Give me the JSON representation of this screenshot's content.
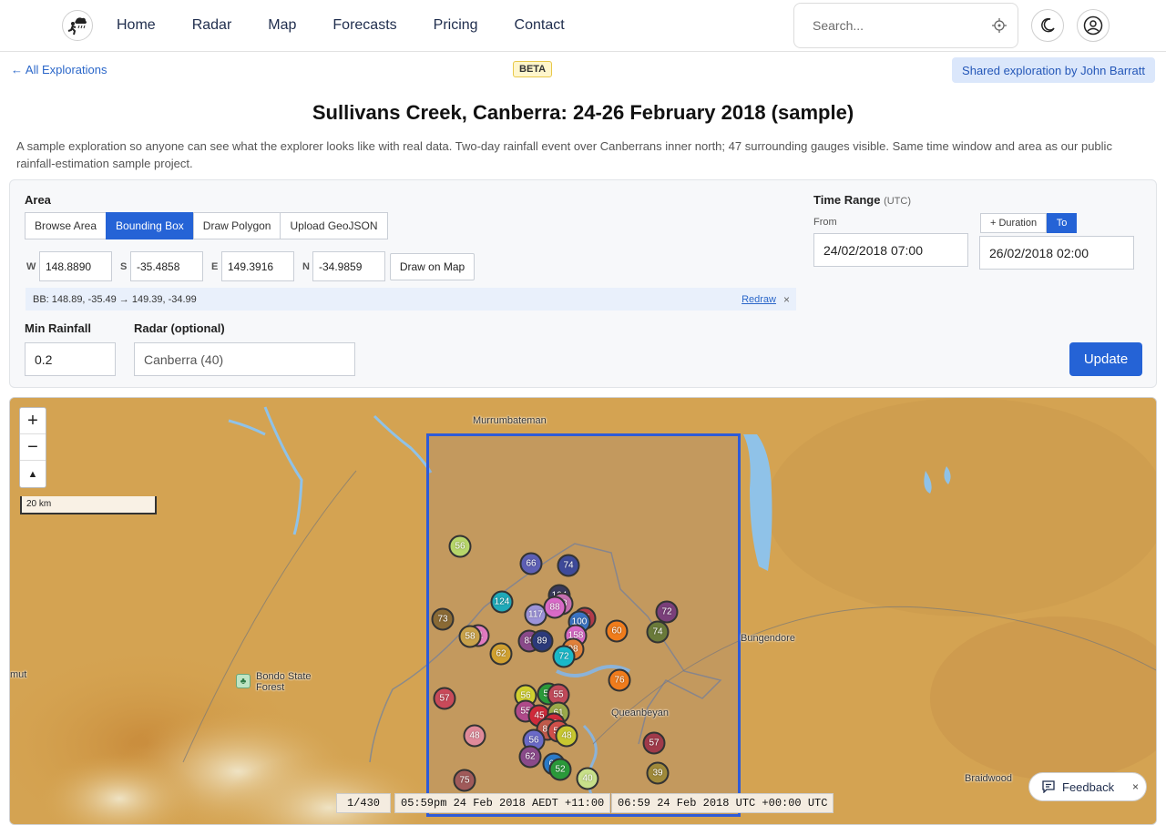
{
  "nav": {
    "links": [
      "Home",
      "Radar",
      "Map",
      "Forecasts",
      "Pricing",
      "Contact"
    ],
    "search_placeholder": "Search..."
  },
  "header": {
    "back_label": "← All Explorations",
    "beta": "BETA",
    "shared": "Shared exploration by John Barratt",
    "title": "Sullivans Creek, Canberra: 24-26 February 2018 (sample)",
    "description": "A sample exploration so anyone can see what the explorer looks like with real data. Two-day rainfall event over Canberrans inner north; 47 surrounding gauges visible. Same time window and area as our public rainfall-estimation sample project."
  },
  "area": {
    "label": "Area",
    "modes": [
      "Browse Area",
      "Bounding Box",
      "Draw Polygon",
      "Upload GeoJSON"
    ],
    "active_mode": "Bounding Box",
    "w_label": "W",
    "w": "148.8890",
    "s_label": "S",
    "s": "-35.4858",
    "e_label": "E",
    "e": "149.3916",
    "n_label": "N",
    "n": "-34.9859",
    "draw_btn": "Draw on Map",
    "bb_text": "BB: 148.89, -35.49 → 149.39, -34.99",
    "redraw": "Redraw",
    "clear": "×"
  },
  "filters": {
    "min_rain_label": "Min Rainfall",
    "min_rain": "0.2",
    "radar_label": "Radar (optional)",
    "radar": "Canberra (40)"
  },
  "time": {
    "label": "Time Range",
    "tz": "(UTC)",
    "from_label": "From",
    "from": "24/02/2018 07:00",
    "duration_btn": "+ Duration",
    "to_btn": "To",
    "to": "26/02/2018 02:00",
    "update": "Update"
  },
  "map": {
    "zoom_in": "+",
    "zoom_out": "−",
    "reset": "▲",
    "scale": "20 km",
    "places": {
      "murrumbateman": "Murrumbateman",
      "bungendore": "Bungendore",
      "queanbeyan": "Queanbeyan",
      "braidwood": "Braidwood",
      "tumut": "mut",
      "bondo": "Bondo State\nForest"
    },
    "markers": [
      {
        "v": "56",
        "c": "#b7d66a"
      },
      {
        "v": "66",
        "c": "#5d5fb5"
      },
      {
        "v": "74",
        "c": "#3e4a9a"
      },
      {
        "v": "104",
        "c": "#3a3a5c"
      },
      {
        "v": "124",
        "c": "#1fa9b8"
      },
      {
        "v": "117",
        "c": "#9c93d8"
      },
      {
        "v": "98",
        "c": "#c56fb1"
      },
      {
        "v": "88",
        "c": "#d96ac7"
      },
      {
        "v": "15",
        "c": "#b23a4a"
      },
      {
        "v": "100",
        "c": "#3a74c4"
      },
      {
        "v": "72",
        "c": "#7a3f7a"
      },
      {
        "v": "73",
        "c": "#8a6a35"
      },
      {
        "v": "71",
        "c": "#e07ac0"
      },
      {
        "v": "58",
        "c": "#c9a24a"
      },
      {
        "v": "83",
        "c": "#8a4a8a"
      },
      {
        "v": "89",
        "c": "#2c3a7a"
      },
      {
        "v": "158",
        "c": "#d96ac7"
      },
      {
        "v": "60",
        "c": "#f07c1c"
      },
      {
        "v": "74",
        "c": "#6a7a3a"
      },
      {
        "v": "62",
        "c": "#d0a030"
      },
      {
        "v": "98",
        "c": "#e0803a"
      },
      {
        "v": "72",
        "c": "#1ab8c8"
      },
      {
        "v": "76",
        "c": "#f07c1c"
      },
      {
        "v": "57",
        "c": "#c94a5a"
      },
      {
        "v": "56",
        "c": "#d0d030"
      },
      {
        "v": "54",
        "c": "#2a9a3a"
      },
      {
        "v": "55",
        "c": "#c04a5a"
      },
      {
        "v": "55",
        "c": "#b04a8a"
      },
      {
        "v": "45",
        "c": "#d02a3a"
      },
      {
        "v": "61",
        "c": "#9aaa4a"
      },
      {
        "v": "87",
        "c": "#d02a3a"
      },
      {
        "v": "84",
        "c": "#c05a4a"
      },
      {
        "v": "53",
        "c": "#d0504a"
      },
      {
        "v": "48",
        "c": "#c8c830"
      },
      {
        "v": "48",
        "c": "#e08a9a"
      },
      {
        "v": "56",
        "c": "#6a6ac8"
      },
      {
        "v": "57",
        "c": "#a03a4a"
      },
      {
        "v": "62",
        "c": "#8a4a8a"
      },
      {
        "v": "64",
        "c": "#2a7ac8"
      },
      {
        "v": "52",
        "c": "#2a9a3a"
      },
      {
        "v": "40",
        "c": "#c8e08a"
      },
      {
        "v": "75",
        "c": "#a05a5a"
      },
      {
        "v": "39",
        "c": "#a08a3a"
      }
    ],
    "frame": "1/430",
    "local_time": "05:59pm 24 Feb 2018 AEDT +11:00",
    "utc_time": "06:59 24 Feb 2018 UTC +00:00 UTC"
  },
  "feedback": {
    "label": "Feedback",
    "close": "×"
  }
}
